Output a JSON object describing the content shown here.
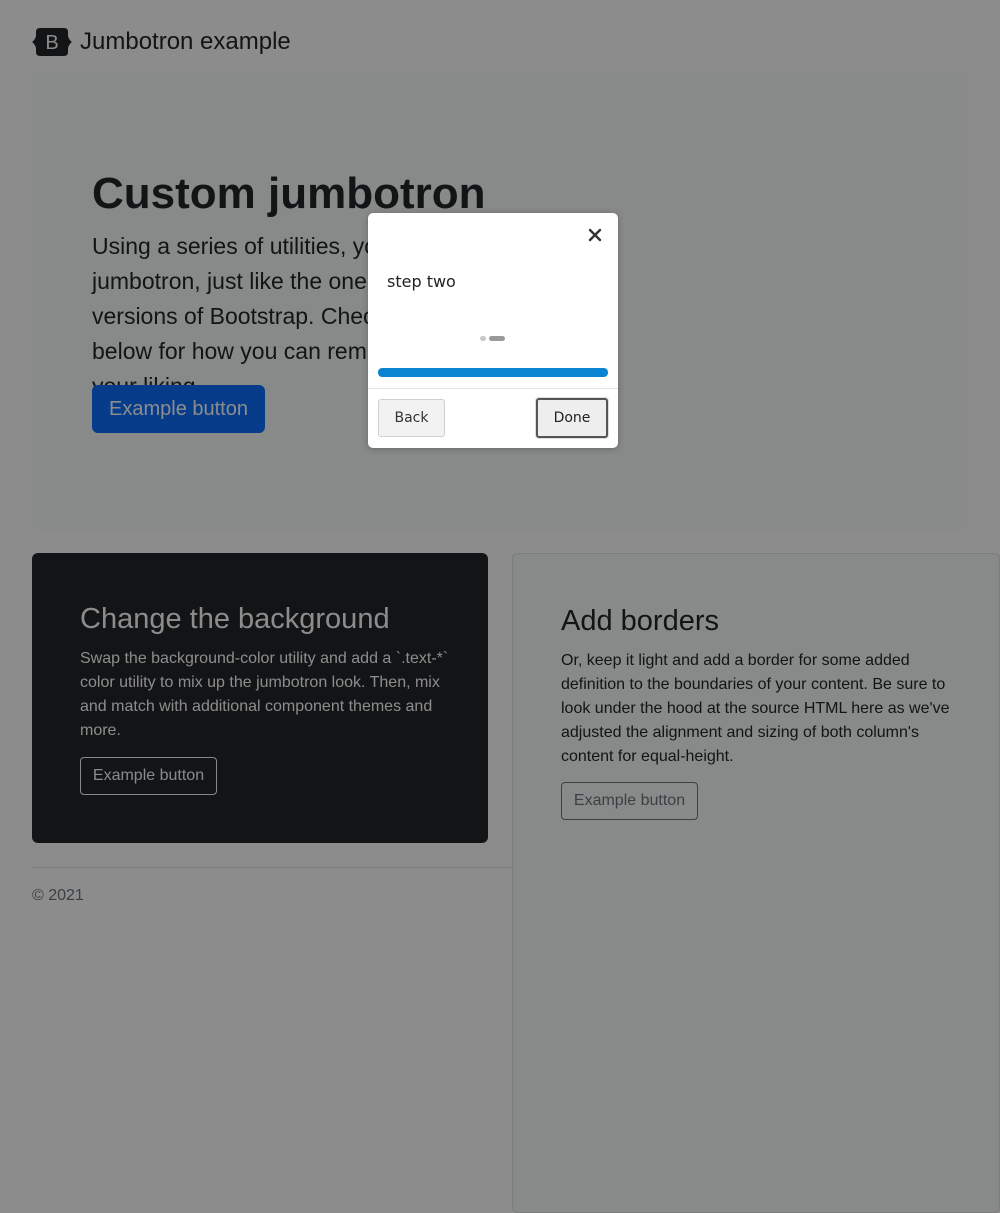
{
  "header": {
    "logo_icon": "bootstrap-logo-icon",
    "title": "Jumbotron example"
  },
  "jumbotron": {
    "title": "Custom jumbotron",
    "text": "Using a series of utilities, you can create this jumbotron, just like the one in previous versions of Bootstrap. Check out the examples below for how you can remix and restyle it to your liking.",
    "button_label": "Example button",
    "button_color": "#0d6efd"
  },
  "columns": {
    "dark": {
      "title": "Change the background",
      "text": "Swap the background-color utility and add a `.text-*` color utility to mix up the jumbotron look. Then, mix and match with additional component themes and more.",
      "button_label": "Example button",
      "background": "#212529"
    },
    "light": {
      "title": "Add borders",
      "text": "Or, keep it light and add a border for some added definition to the boundaries of your content. Be sure to look under the hood at the source HTML here as we've adjusted the alignment and sizing of both column's content for equal-height.",
      "button_label": "Example button"
    }
  },
  "footer": {
    "text": "© 2021"
  },
  "tour": {
    "close_icon": "close-icon",
    "step_text": "step two",
    "current_step": 2,
    "total_steps": 2,
    "progress_percent": 100,
    "progress_color": "#0a84d0",
    "back_label": "Back",
    "done_label": "Done"
  }
}
